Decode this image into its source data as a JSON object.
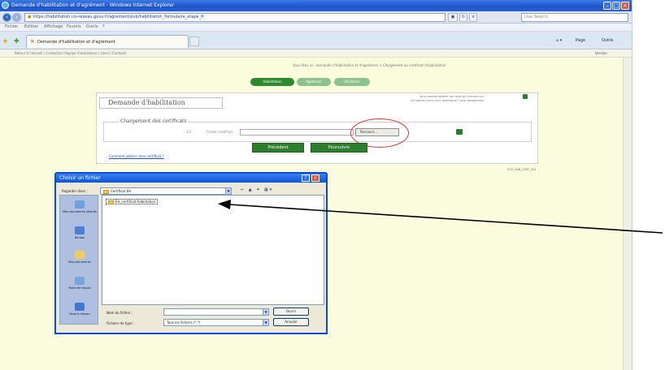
{
  "browser": {
    "window_title": "Demande d'habilitation et d'agrément - Windows Internet Explorer",
    "url": "https://habilitation.ics-reseau.gouv.fr/agrement/pub/habilitation_formulaire_etape_fr",
    "search_placeholder": "Live Search",
    "menu": [
      "Fichier",
      "Edition",
      "Affichage",
      "Favoris",
      "Outils",
      "?"
    ],
    "tab_title": "Demande d'habilitation et d'agrément",
    "commands": {
      "page": "Page",
      "tools": "Outils"
    },
    "info_text": "Retour à l'accueil | Contactez l'équipe d'assistance | Liens | Contacts",
    "info_right": "Version"
  },
  "page": {
    "welcome": "Vous êtes ici : demande d'habilitation et d'agrément > Chargement du certificat d'habilitation",
    "steps": [
      "Habilitation",
      "Agrément",
      "Validation"
    ],
    "panel_title": "Demande d'habilitation",
    "help_line1": "Vous pouvez obtenir de l'aide en cliquant sur",
    "help_line2": "Les points suivis d'un astérisque * sont obligatoires",
    "section_legend": "Chargement des certificats",
    "field_prefix": "1/1",
    "field_label": "Fichier certificat",
    "browse_button": "Parcourir...",
    "prev_button": "Précédent",
    "next_button": "Poursuivre",
    "cert_link": "Comment obtenir mon certificat ?",
    "ref_code": "ECR_HAB_CERT_002"
  },
  "dialog": {
    "title": "Choisir un fichier",
    "look_in_label": "Regarder dans :",
    "look_in_value": "Certificat EH",
    "places": [
      "Mes documents récents",
      "Bureau",
      "Mes documents",
      "Poste de travail",
      "Favoris réseau"
    ],
    "file_item": "EH_certificat-habilitation",
    "filename_label": "Nom du fichier :",
    "filename_value": "",
    "filetype_label": "Fichiers de type :",
    "filetype_value": "Tous les fichiers (*.*)",
    "open_button": "Ouvrir",
    "cancel_button": "Annuler"
  },
  "annotation": {
    "color": "#000000",
    "highlight_color": "#e0302f"
  }
}
